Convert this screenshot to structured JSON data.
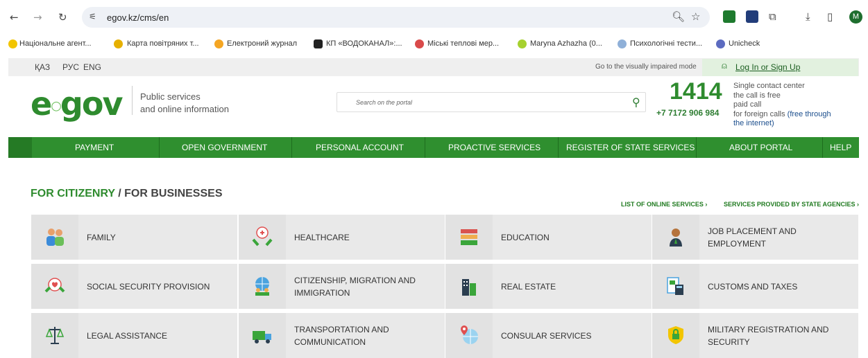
{
  "browser": {
    "url": "egov.kz/cms/en",
    "bookmarks": [
      "Національне агент...",
      "Карта повітряних т...",
      "Електроний журнал",
      "КП «ВОДОКАНАЛ»:...",
      "Міські теплові мер...",
      "Maryna Azhazha (0...",
      "Психологічні тести...",
      "Unicheck"
    ],
    "profile_initial": "M"
  },
  "topbar": {
    "langs": [
      "ҚАЗ",
      "РУС",
      "ENG"
    ],
    "impaired_link": "Go to the visually impaired mode",
    "login": "Log In or Sign Up"
  },
  "header": {
    "logo": "egov",
    "tagline_1": "Public services",
    "tagline_2": "and online information",
    "search_placeholder": "Search on the portal",
    "phone_short": "1414",
    "phone_full": "+7 7172 906 984",
    "contact_1": "Single contact center",
    "contact_2": "the call is free",
    "contact_3": "paid call",
    "contact_4": "for foreign calls",
    "contact_5": "(free through",
    "contact_6": "the internet)"
  },
  "nav": [
    "PAYMENT",
    "OPEN GOVERNMENT",
    "PERSONAL ACCOUNT",
    "PROACTIVE SERVICES",
    "REGISTER OF STATE SERVICES",
    "ABOUT PORTAL",
    "HELP"
  ],
  "section": {
    "title_main": "FOR CITIZENRY",
    "title_sep": " / ",
    "title_alt": "FOR BUSINESSES",
    "link_online": "LIST OF ONLINE SERVICES ›",
    "link_state": "SERVICES PROVIDED BY STATE AGENCIES ›"
  },
  "tiles": [
    "FAMILY",
    "HEALTHCARE",
    "EDUCATION",
    "JOB PLACEMENT AND EMPLOYMENT",
    "SOCIAL SECURITY PROVISION",
    "CITIZENSHIP, MIGRATION AND IMMIGRATION",
    "REAL ESTATE",
    "CUSTOMS AND TAXES",
    "LEGAL ASSISTANCE",
    "TRANSPORTATION AND COMMUNICATION",
    "CONSULAR SERVICES",
    "MILITARY REGISTRATION AND SECURITY"
  ]
}
